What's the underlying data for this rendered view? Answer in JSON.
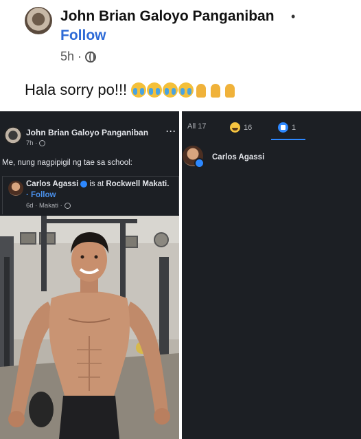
{
  "top_post": {
    "author": "John Brian Galoyo Panganiban",
    "separator": "•",
    "follow": "Follow",
    "time": "5h ·",
    "text": "Hala sorry po!!!",
    "emojis": [
      "loudly-crying-face",
      "loudly-crying-face",
      "loudly-crying-face",
      "loudly-crying-face",
      "folded-hands",
      "folded-hands",
      "folded-hands"
    ]
  },
  "left_post": {
    "author": "John Brian Galoyo Panganiban",
    "more": "···",
    "time": "7h ·",
    "text": "Me, nung nagpipigil ng tae sa school:",
    "shared": {
      "author": "Carlos Agassi",
      "is_at": "is at",
      "place": "Rockwell Makati.",
      "follow": "· Follow",
      "time": "6d · Makati ·"
    }
  },
  "reactions": {
    "tabs": [
      {
        "label": "All 17"
      },
      {
        "icon": "haha-icon",
        "count": "16"
      },
      {
        "icon": "like-icon",
        "count": "1"
      }
    ],
    "active_tab_color": "#2d88ff",
    "people": [
      {
        "name": "Carlos Agassi",
        "reaction": "like-icon"
      }
    ]
  },
  "colors": {
    "dark_bg": "#1c1f24",
    "follow_blue": "#2d6ad6",
    "like_blue": "#2d88ff"
  }
}
